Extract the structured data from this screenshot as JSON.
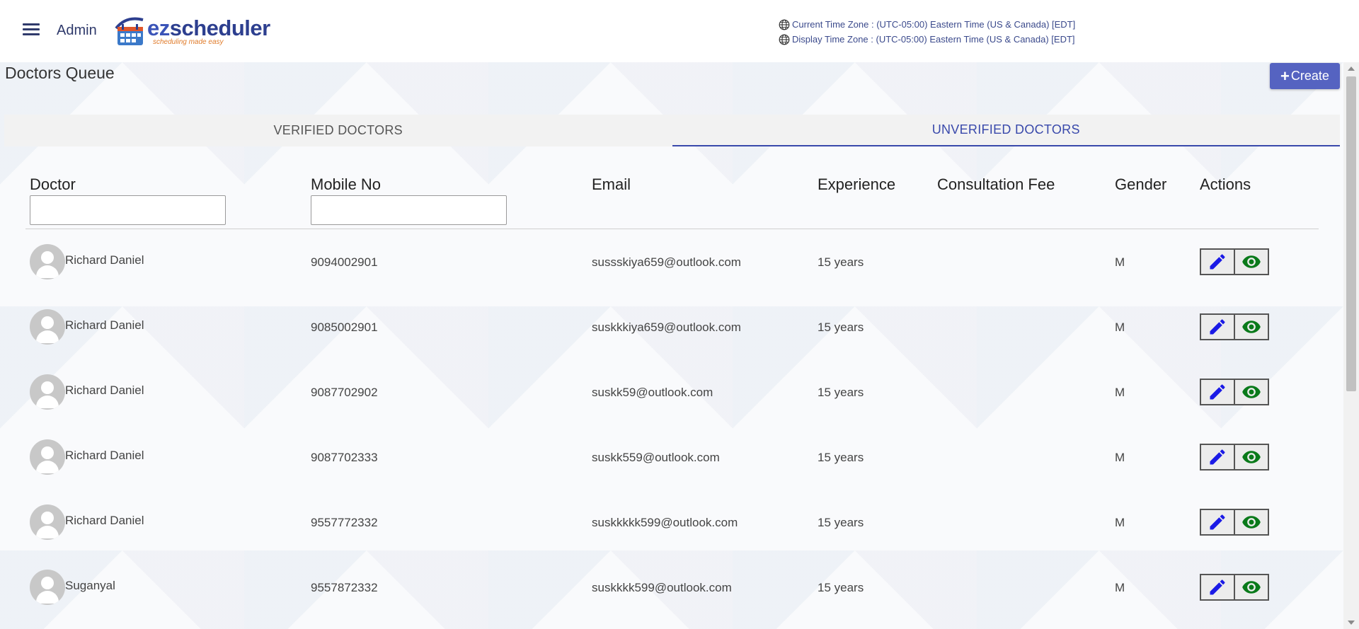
{
  "header": {
    "role_label": "Admin",
    "logo_ez": "ez",
    "logo_scheduler": "scheduler",
    "logo_tagline": "scheduling made easy",
    "current_tz": "Current Time Zone : (UTC-05:00) Eastern Time (US & Canada) [EDT]",
    "display_tz": "Display Time Zone : (UTC-05:00) Eastern Time (US & Canada) [EDT]"
  },
  "page": {
    "title": "Doctors Queue",
    "create_label": "Create"
  },
  "tabs": [
    {
      "label": "VERIFIED DOCTORS",
      "active": false
    },
    {
      "label": "UNVERIFIED DOCTORS",
      "active": true
    }
  ],
  "table": {
    "columns": [
      "Doctor",
      "Mobile No",
      "Email",
      "Experience",
      "Consultation Fee",
      "Gender",
      "Actions"
    ],
    "filters": {
      "doctor": "",
      "mobile": ""
    },
    "rows": [
      {
        "name": "Richard Daniel",
        "mobile": "9094002901",
        "email": "sussskiya659@outlook.com",
        "experience": "15 years",
        "fee": "",
        "gender": "M"
      },
      {
        "name": "Richard Daniel",
        "mobile": "9085002901",
        "email": "suskkkiya659@outlook.com",
        "experience": "15 years",
        "fee": "",
        "gender": "M"
      },
      {
        "name": "Richard Daniel",
        "mobile": "9087702902",
        "email": "suskk59@outlook.com",
        "experience": "15 years",
        "fee": "",
        "gender": "M"
      },
      {
        "name": "Richard Daniel",
        "mobile": "9087702333",
        "email": "suskk559@outlook.com",
        "experience": "15 years",
        "fee": "",
        "gender": "M"
      },
      {
        "name": "Richard Daniel",
        "mobile": "9557772332",
        "email": "suskkkkk599@outlook.com",
        "experience": "15 years",
        "fee": "",
        "gender": "M"
      },
      {
        "name": "Suganyal",
        "mobile": "9557872332",
        "email": "suskkkk599@outlook.com",
        "experience": "15 years",
        "fee": "",
        "gender": "M"
      }
    ]
  },
  "colors": {
    "accent": "#3949ab",
    "create_button": "#5563c1",
    "edit_icon": "#1a1ae6",
    "view_icon": "#0a7a1a"
  },
  "icons": {
    "menu": "hamburger-menu-icon",
    "globe": "globe-icon",
    "edit": "pencil-icon",
    "view": "eye-icon",
    "avatar": "user-avatar-icon"
  }
}
